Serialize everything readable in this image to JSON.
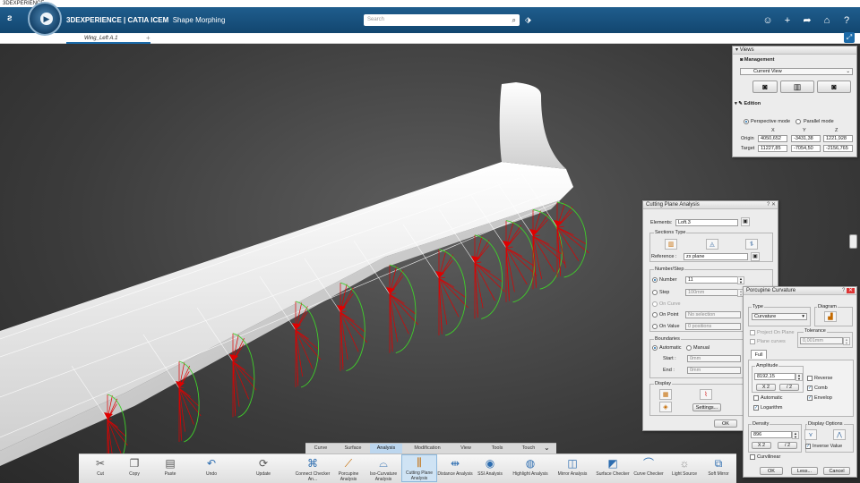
{
  "window": {
    "title": "3DEXPERIENCE"
  },
  "app": {
    "brand": "3DEXPERIENCE | CATIA ICEM",
    "product": "Shape Morphing",
    "search_placeholder": "Search"
  },
  "tabs": [
    {
      "label": "Wing_Left A.1"
    }
  ],
  "views_panel": {
    "title": "Views",
    "management_label": "Management",
    "current_view": "Current View",
    "edition_label": "Edition",
    "perspective_label": "Perspective mode",
    "parallel_label": "Parallel mode",
    "col_x": "X",
    "col_y": "Y",
    "col_z": "Z",
    "origin_label": "Origin",
    "origin": [
      "4050,652",
      "-3431,38",
      "1221,928"
    ],
    "target_label": "Target",
    "target": [
      "11227,85",
      "-7054,50",
      "-2156,765"
    ]
  },
  "cutting_plane": {
    "title": "Cutting Plane Analysis",
    "elements_label": "Elements:",
    "elements_value": "Loft.3",
    "sections_type_label": "Sections Type",
    "reference_label": "Reference :",
    "reference_value": "zx plane",
    "number_step_label": "Number/Step",
    "number_label": "Number",
    "number_value": "11",
    "step_label": "Step",
    "step_value": "100mm",
    "on_curve_label": "On Curve",
    "on_point_label": "On Point",
    "on_point_value": "No selection",
    "on_value_label": "On Value",
    "on_value_value": "0 positions",
    "boundaries_label": "Boundaries",
    "automatic_label": "Automatic",
    "manual_label": "Manual",
    "start_label": "Start :",
    "start_value": "0mm",
    "end_label": "End :",
    "end_value": "0mm",
    "display_label": "Display",
    "settings_label": "Settings...",
    "ok_label": "OK"
  },
  "porcupine": {
    "title": "Porcupine Curvature",
    "type_label": "Type",
    "type_value": "Curvature",
    "diagram_label": "Diagram",
    "project_on_plane": "Project On Plane",
    "plane_curves": "Plane curves",
    "tolerance_label": "Tolerance",
    "tolerance_value": "0,001mm",
    "full_tab": "Full",
    "amplitude_label": "Amplitude",
    "amplitude_value": "8192,15",
    "x2_label": "X 2",
    "div2_label": "/ 2",
    "reverse_label": "Reverse",
    "comb_label": "Comb",
    "envelop_label": "Envelop",
    "automatic_label": "Automatic",
    "logarithm_label": "Logarithm",
    "density_label": "Density",
    "density_value": "896",
    "display_options_label": "Display Options",
    "inverse_value_label": "Inverse Value",
    "curvilinear_label": "Curvilinear",
    "ok_label": "OK",
    "less_label": "Less...",
    "cancel_label": "Cancel"
  },
  "action_tabs": [
    "Curve",
    "Surface",
    "Analysis",
    "Modification",
    "View",
    "Tools",
    "Touch"
  ],
  "selected_action_tab": "Analysis",
  "toolbar": [
    {
      "label": "Cut",
      "icon": "scissors-icon"
    },
    {
      "label": "Copy",
      "icon": "copy-icon"
    },
    {
      "label": "Paste",
      "icon": "paste-icon"
    },
    {
      "label": "Undo",
      "icon": "undo-icon"
    },
    {
      "label": "Update",
      "icon": "update-icon"
    },
    {
      "label": "Connect Checker An...",
      "icon": "connect-checker-icon"
    },
    {
      "label": "Porcupine Analysis",
      "icon": "porcupine-icon"
    },
    {
      "label": "Iso-Curvature Analysis",
      "icon": "iso-curvature-icon"
    },
    {
      "label": "Cutting Plane Analysis",
      "icon": "cutting-plane-icon"
    },
    {
      "label": "Distance Analysis",
      "icon": "distance-icon"
    },
    {
      "label": "SSI Analysis",
      "icon": "ssi-icon"
    },
    {
      "label": "Highlight Analysis",
      "icon": "highlight-icon"
    },
    {
      "label": "Mirror Analysis",
      "icon": "mirror-analysis-icon"
    },
    {
      "label": "Surface Checker",
      "icon": "surface-checker-icon"
    },
    {
      "label": "Curve Checker",
      "icon": "curve-checker-icon"
    },
    {
      "label": "Light Source",
      "icon": "light-source-icon"
    },
    {
      "label": "Soft Mirror",
      "icon": "soft-mirror-icon"
    }
  ],
  "colors": {
    "header_blue": "#1b5585",
    "porcupine_red": "#e00000",
    "envelope_green": "#3fcf2a"
  }
}
